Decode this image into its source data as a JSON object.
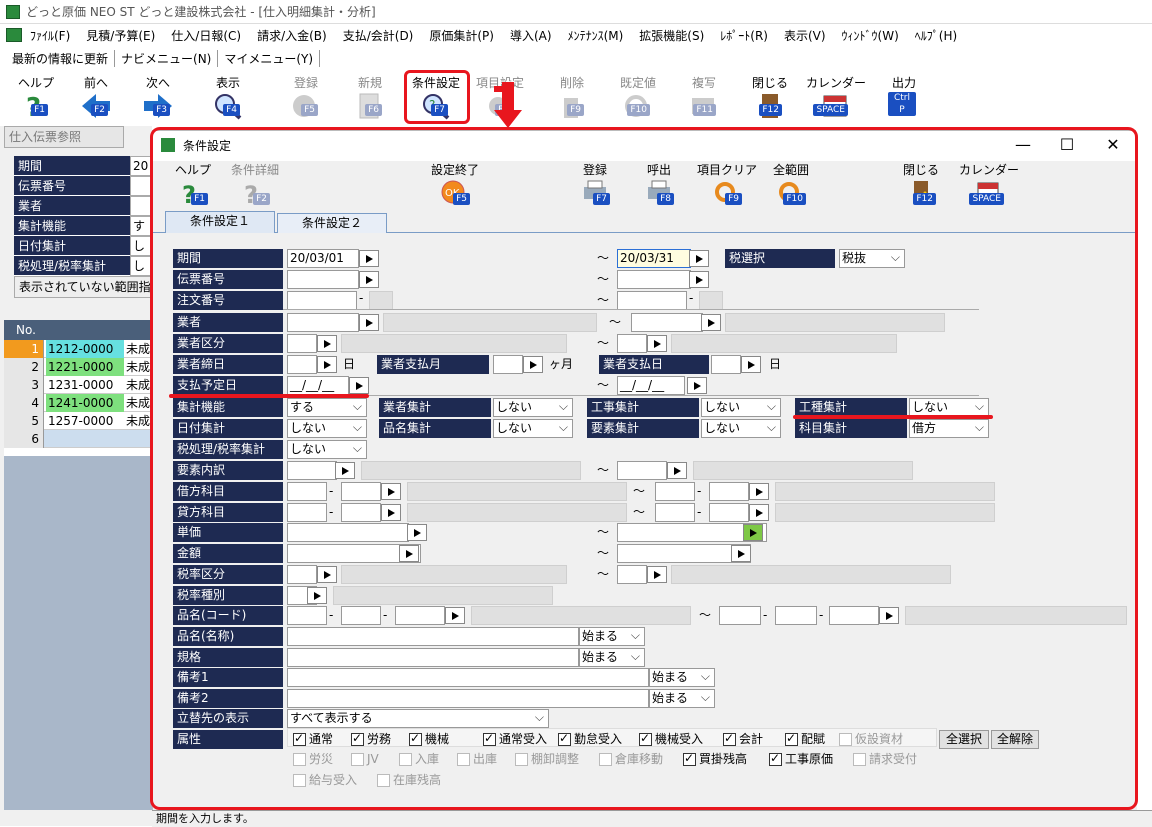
{
  "window": {
    "title": "どっと原価 NEO ST どっと建設株式会社 - [仕入明細集計・分析]"
  },
  "menu": [
    "ﾌｧｲﾙ(F)",
    "見積/予算(E)",
    "仕入/日報(C)",
    "請求/入金(B)",
    "支払/会計(D)",
    "原価集計(P)",
    "導入(A)",
    "ﾒﾝﾃﾅﾝｽ(M)",
    "拡張機能(S)",
    "ﾚﾎﾟｰﾄ(R)",
    "表示(V)",
    "ｳｨﾝﾄﾞｳ(W)",
    "ﾍﾙﾌﾟ(H)"
  ],
  "subbar": [
    "最新の情報に更新",
    "ナビメニュー(N)",
    "マイメニュー(Y)"
  ],
  "toolbar": [
    {
      "label": "ヘルプ",
      "key": "F1"
    },
    {
      "label": "前へ",
      "key": "F2"
    },
    {
      "label": "次へ",
      "key": "F3"
    },
    {
      "label": "表示",
      "key": "F4"
    },
    {
      "label": "登録",
      "key": "F5"
    },
    {
      "label": "新規",
      "key": "F6"
    },
    {
      "label": "条件設定",
      "key": "F7"
    },
    {
      "label": "項目設定",
      "key": "F8"
    },
    {
      "label": "削除",
      "key": "F9"
    },
    {
      "label": "既定値",
      "key": "F10"
    },
    {
      "label": "複写",
      "key": "F11"
    },
    {
      "label": "閉じる",
      "key": "F12"
    },
    {
      "label": "カレンダー",
      "key": "SPACE"
    },
    {
      "label": "出力",
      "key": "Ctrl P"
    }
  ],
  "left": {
    "button": "仕入伝票参照",
    "rows": [
      {
        "label": "期間",
        "val": "20"
      },
      {
        "label": "伝票番号",
        "val": ""
      },
      {
        "label": "業者",
        "val": ""
      },
      {
        "label": "集計機能",
        "val": "す"
      },
      {
        "label": "日付集計",
        "val": "し"
      },
      {
        "label": "税処理/税率集計",
        "val": "し"
      }
    ],
    "note": "表示されていない範囲指",
    "grid_header": "No.",
    "grid": [
      {
        "n": "1",
        "code": "1212-0000",
        "st": "未成"
      },
      {
        "n": "2",
        "code": "1221-0000",
        "st": "未成"
      },
      {
        "n": "3",
        "code": "1231-0000",
        "st": "未成"
      },
      {
        "n": "4",
        "code": "1241-0000",
        "st": "未成"
      },
      {
        "n": "5",
        "code": "1257-0000",
        "st": "未成"
      },
      {
        "n": "6",
        "code": "",
        "st": ""
      }
    ]
  },
  "dialog": {
    "title": "条件設定",
    "tool": [
      {
        "label": "ヘルプ",
        "key": "F1"
      },
      {
        "label": "条件詳細",
        "key": "F2"
      },
      {
        "label": "設定終了",
        "key": "F5"
      },
      {
        "label": "登録",
        "key": "F7"
      },
      {
        "label": "呼出",
        "key": "F8"
      },
      {
        "label": "項目クリア",
        "key": "F9"
      },
      {
        "label": "全範囲",
        "key": "F10"
      },
      {
        "label": "閉じる",
        "key": "F12"
      },
      {
        "label": "カレンダー",
        "key": "SPACE"
      }
    ],
    "tabs": [
      "条件設定１",
      "条件設定２"
    ],
    "labels": {
      "period": "期間",
      "slip": "伝票番号",
      "order": "注文番号",
      "vendor": "業者",
      "vendor_cls": "業者区分",
      "vendor_close": "業者締日",
      "vendor_paymonth": "業者支払月",
      "vendor_payday": "業者支払日",
      "pay_plan": "支払予定日",
      "agg": "集計機能",
      "vendor_agg": "業者集計",
      "work_agg": "工事集計",
      "kind_agg": "工種集計",
      "date_agg": "日付集計",
      "item_agg": "品名集計",
      "elem_agg": "要素集計",
      "acct_agg": "科目集計",
      "tax_agg": "税処理/税率集計",
      "elem": "要素内訳",
      "debit": "借方科目",
      "credit": "貸方科目",
      "price": "単価",
      "amount": "金額",
      "tax_cls": "税率区分",
      "tax_kind": "税率種別",
      "item_code": "品名(コード)",
      "item_name": "品名(名称)",
      "spec": "規格",
      "note1": "備考1",
      "note2": "備考2",
      "advance": "立替先の表示",
      "attr": "属性",
      "tax_sel": "税選択"
    },
    "values": {
      "date_from": "20/03/01",
      "date_to": "20/03/31",
      "tax": "税抜",
      "agg": "する",
      "vendor_agg": "しない",
      "work_agg": "しない",
      "kind_agg": "しない",
      "date_agg": "しない",
      "item_agg": "しない",
      "elem_agg": "しない",
      "acct_agg": "借方",
      "tax_agg": "しない",
      "blank_date": "__/__/__",
      "day": "日",
      "month": "ヶ月",
      "tilde": "～",
      "dash": "-",
      "starts": "始まる",
      "advance": "すべて表示する"
    },
    "attrs_row1": [
      {
        "t": "通常",
        "on": true
      },
      {
        "t": "労務",
        "on": true
      },
      {
        "t": "機械",
        "on": true
      },
      {
        "t": "通常受入",
        "on": true
      },
      {
        "t": "勤怠受入",
        "on": true
      },
      {
        "t": "機械受入",
        "on": true
      },
      {
        "t": "会計",
        "on": true
      },
      {
        "t": "配賦",
        "on": true
      },
      {
        "t": "仮設資材",
        "on": false
      }
    ],
    "attrs_row2": [
      {
        "t": "労災",
        "on": false
      },
      {
        "t": "JV",
        "on": false
      },
      {
        "t": "入庫",
        "on": false
      },
      {
        "t": "出庫",
        "on": false
      },
      {
        "t": "棚卸調整",
        "on": false
      },
      {
        "t": "倉庫移動",
        "on": false
      },
      {
        "t": "買掛残高",
        "on": true
      },
      {
        "t": "工事原価",
        "on": true
      },
      {
        "t": "請求受付",
        "on": false
      }
    ],
    "attrs_row3": [
      {
        "t": "給与受入",
        "on": false
      },
      {
        "t": "在庫残高",
        "on": false
      }
    ],
    "select_all": "全選択",
    "deselect_all": "全解除"
  },
  "status": "期間を入力します。",
  "colors": {
    "accent_red": "#e8161e",
    "label_bg": "#1e2a52",
    "row_cyan": "#66e0e0",
    "row_green": "#7ee07e",
    "row_orange": "#f29a1e"
  }
}
